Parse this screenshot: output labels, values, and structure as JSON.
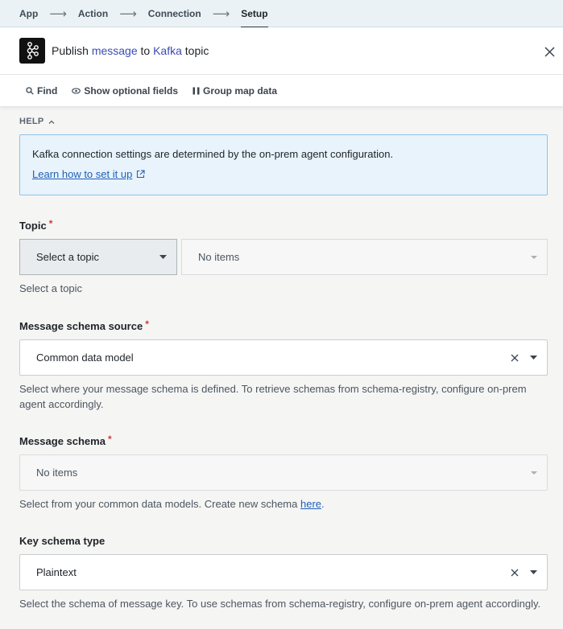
{
  "breadcrumb": {
    "items": [
      "App",
      "Action",
      "Connection",
      "Setup"
    ]
  },
  "header": {
    "title_prefix": "Publish",
    "title_pill_1": "message",
    "title_mid": "to",
    "title_pill_2": "Kafka",
    "title_suffix": "topic"
  },
  "toolbar": {
    "find": "Find",
    "optional": "Show optional fields",
    "group": "Group map data"
  },
  "help": {
    "toggle": "HELP",
    "text": "Kafka connection settings are determined by the on-prem agent configuration.",
    "link": "Learn how to set it up"
  },
  "fields": {
    "topic": {
      "label": "Topic",
      "select": "Select a topic",
      "items": "No items",
      "hint": "Select a topic"
    },
    "schema_source": {
      "label": "Message schema source",
      "value": "Common data model",
      "hint": "Select where your message schema is defined. To retrieve schemas from schema-registry, configure on-prem agent accordingly."
    },
    "schema": {
      "label": "Message schema",
      "value": "No items",
      "hint_prefix": "Select from your common data models. Create new schema",
      "hint_link": "here",
      "hint_suffix": "."
    },
    "key_schema": {
      "label": "Key schema type",
      "value": "Plaintext",
      "hint": "Select the schema of message key. To use schemas from schema-registry, configure on-prem agent accordingly."
    }
  }
}
